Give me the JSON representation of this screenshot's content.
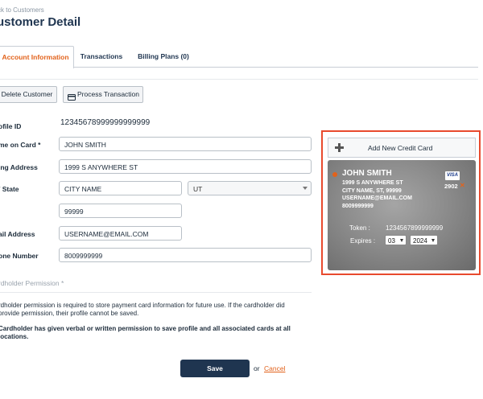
{
  "header": {
    "back_link": "ck to Customers",
    "title": "ustomer Detail"
  },
  "tabs": [
    {
      "label": "Account Information",
      "active": true
    },
    {
      "label": "Transactions",
      "active": false
    },
    {
      "label": "Billing Plans (0)",
      "active": false
    }
  ],
  "toolbar": {
    "delete_label": "Delete Customer",
    "process_label": "Process Transaction",
    "process_icon": "credit-card-icon"
  },
  "form": {
    "profile_id_label": "ofile ID",
    "profile_id_value": "12345678999999999999",
    "name_label": "me on Card *",
    "name_value": "JOHN SMITH",
    "address_label": "ing Address",
    "address_value": "1999 S ANYWHERE ST",
    "city_state_label": "/ State",
    "city_value": "CITY NAME",
    "state_value": "UT",
    "zip_value": "99999",
    "email_label": "ail Address",
    "email_value": "USERNAME@EMAIL.COM",
    "phone_label": "one Number",
    "phone_value": "8009999999"
  },
  "permission": {
    "heading": "rdholder Permission *",
    "text": "rdholder permission is required to store payment card information for future use. If the cardholder did provide permission, their profile cannot be saved.",
    "checkbox_text": "Cardholder has given verbal or written permission to save profile and all associated cards at all locations."
  },
  "actions": {
    "save_label": "Save",
    "or_text": "or",
    "cancel_label": "Cancel"
  },
  "credit_card_panel": {
    "add_label": "Add New Credit Card",
    "add_icon": "plus-icon",
    "highlight_color": "#e84a2e",
    "card": {
      "name": "JOHN SMITH",
      "address_line1": "1999 S ANYWHERE ST",
      "address_line2": "CITY NAME, ST, 99999",
      "email": "USERNAME@EMAIL.COM",
      "phone": "8009999999",
      "brand": "VISA",
      "last4": "2902",
      "token_label": "Token :",
      "token_value": "1234567899999999",
      "expires_label": "Expires :",
      "exp_month": "03",
      "exp_year": "2024"
    }
  },
  "colors": {
    "accent_orange": "#e2621b",
    "navy": "#1f3550"
  }
}
